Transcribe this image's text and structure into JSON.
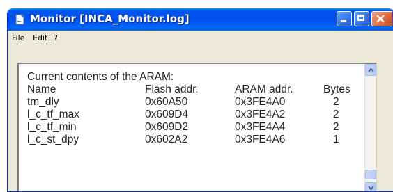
{
  "window": {
    "title": "Monitor [INCA_Monitor.log]"
  },
  "menu": {
    "items": [
      "File",
      "Edit",
      "?"
    ]
  },
  "log": {
    "heading": "Current contents of the ARAM:",
    "columns": [
      "Name",
      "Flash addr.",
      "ARAM addr.",
      "Bytes"
    ],
    "rows": [
      [
        "tm_dly",
        "0x60A50",
        "0x3FE4A0",
        "2"
      ],
      [
        "l_c_tf_max",
        "0x609D4",
        "0x3FE4A2",
        "2"
      ],
      [
        "l_c_tf_min",
        "0x609D2",
        "0x3FE4A4",
        "2"
      ],
      [
        "l_c_st_dpy",
        "0x602A2",
        "0x3FE4A6",
        "1"
      ]
    ]
  },
  "icons": {
    "app": "notepad-icon",
    "minimize": "minimize-icon",
    "maximize": "maximize-icon",
    "close": "close-icon",
    "scroll_up": "scroll-up-arrow-icon",
    "scroll_down": "scroll-down-arrow-icon"
  },
  "colors": {
    "titlebar": "#0053ee",
    "window_bg": "#ece9d8",
    "close_button": "#d04010"
  }
}
